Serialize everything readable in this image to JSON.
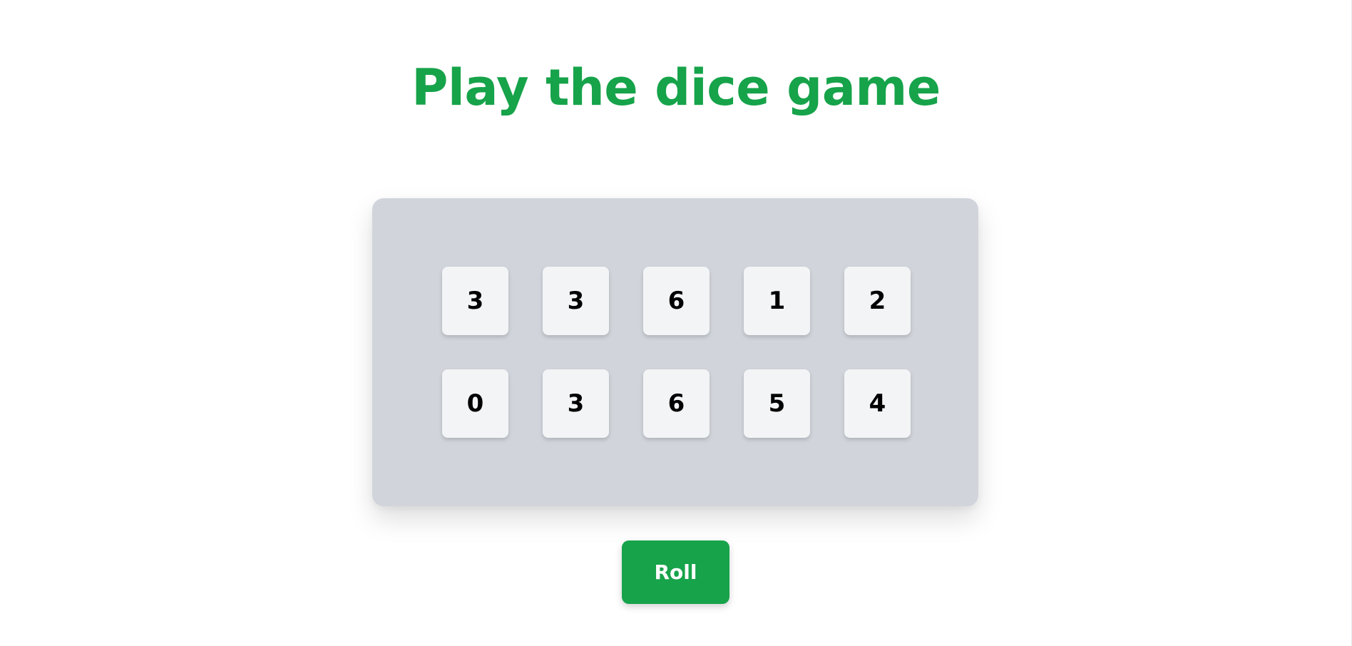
{
  "title": "Play the dice game",
  "board": {
    "dice": [
      {
        "value": "3"
      },
      {
        "value": "3"
      },
      {
        "value": "6"
      },
      {
        "value": "1"
      },
      {
        "value": "2"
      },
      {
        "value": "0"
      },
      {
        "value": "3"
      },
      {
        "value": "6"
      },
      {
        "value": "5"
      },
      {
        "value": "4"
      }
    ]
  },
  "roll_button": {
    "label": "Roll"
  },
  "colors": {
    "accent": "#16a34a",
    "board_bg": "#d1d5db",
    "die_bg": "#f3f4f6",
    "page_bg": "#ffffff"
  }
}
